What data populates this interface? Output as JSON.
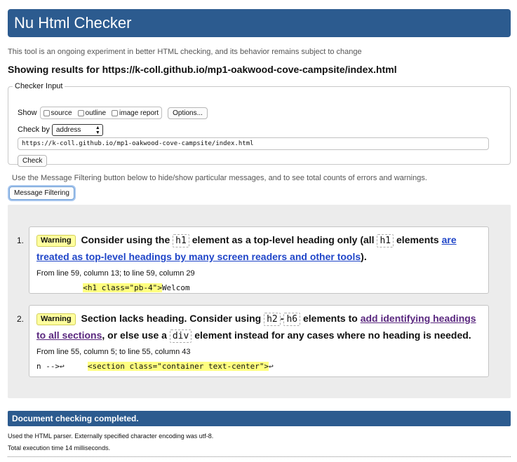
{
  "header": {
    "title": "Nu Html Checker"
  },
  "intro": "This tool is an ongoing experiment in better HTML checking, and its behavior remains subject to change",
  "results_for": "Showing results for https://k-coll.github.io/mp1-oakwood-cove-campsite/index.html",
  "checker_input": {
    "legend": "Checker Input",
    "show_label": "Show",
    "checkboxes": [
      "source",
      "outline",
      "image report"
    ],
    "options_button": "Options...",
    "check_by_label": "Check by",
    "check_by_value": "address",
    "url": "https://k-coll.github.io/mp1-oakwood-cove-campsite/index.html",
    "check_button": "Check"
  },
  "filter_hint": "Use the Message Filtering button below to hide/show particular messages, and to see total counts of errors and warnings.",
  "filter_button": "Message Filtering",
  "messages": [
    {
      "number": "1.",
      "type": "Warning",
      "text_a": "Consider using the",
      "code_a": "h1",
      "text_b": "element as a top-level heading only (all",
      "code_b": "h1",
      "text_c": "elements",
      "link": "are treated as top-level headings by many screen readers and other tools",
      "text_d": ").",
      "location": "From line 59, column 13; to line 59, column 29",
      "extract_pre": "          ",
      "extract_hl": "<h1 class=\"pb-4\">",
      "extract_post": "Welcom"
    },
    {
      "number": "2.",
      "type": "Warning",
      "text_a": "Section lacks heading. Consider using",
      "code_a": "h2",
      "dash": "-",
      "code_b": "h6",
      "text_b": "elements to",
      "link": "add identifying headings to all sections",
      "text_c": ", or else use a",
      "code_c": "div",
      "text_d": "element instead for any cases where no heading is needed.",
      "location": "From line 55, column 5; to line 55, column 43",
      "extract_pre": "n -->↩     ",
      "extract_hl": "<section class=\"container text-center\">",
      "extract_post": "↩"
    }
  ],
  "completed": "Document checking completed.",
  "footer": {
    "parser": "Used the HTML parser. Externally specified character encoding was utf-8.",
    "time": "Total execution time 14 milliseconds."
  },
  "colors": {
    "header_bg": "#2c5b8f",
    "warning_badge": "#ffff9e",
    "highlight": "#ffff80",
    "link": "#1f45c8",
    "visited_link": "#5a287f"
  }
}
